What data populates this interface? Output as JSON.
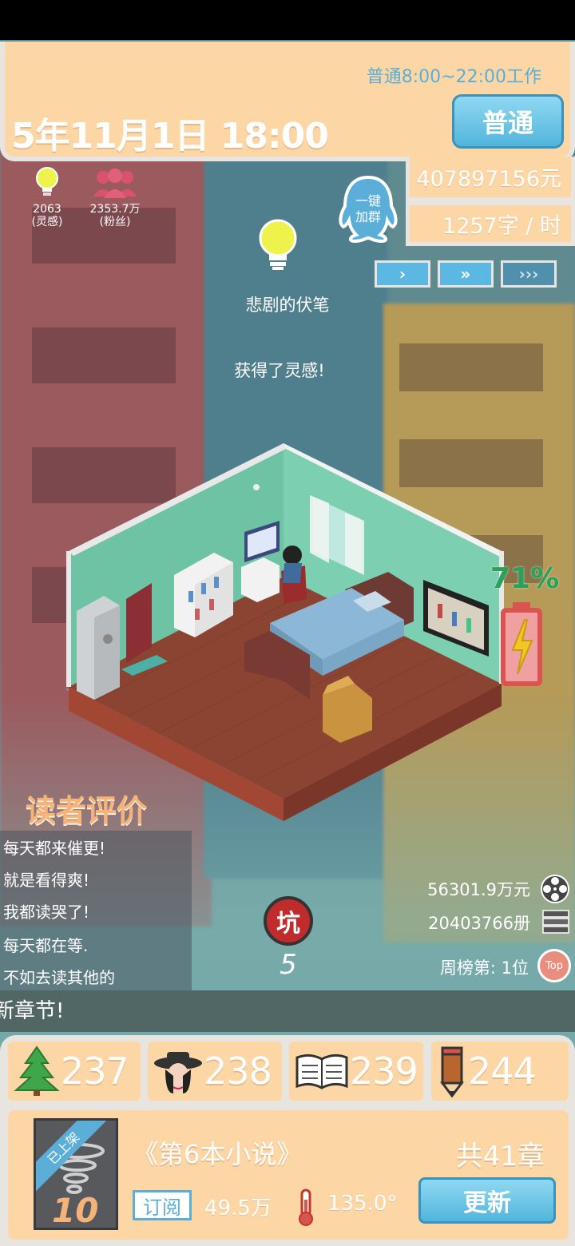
{
  "header": {
    "work_hours": "普通8:00~22:00工作",
    "date_time": "5年11月1日    18:00",
    "mode_button": "普通"
  },
  "stats": {
    "money": "407897156元",
    "writing_speed": "1257字 / 时",
    "inspiration_value": "2063",
    "inspiration_label": "(灵感)",
    "fans_value": "2353.7万",
    "fans_label": "(粉丝)"
  },
  "qq_group": {
    "line1": "一键",
    "line2": "加群"
  },
  "speed_controls": {
    "speed1": "›",
    "speed2": "»",
    "speed3": "›››"
  },
  "event": {
    "title": "悲剧的伏笔",
    "message": "获得了灵感!"
  },
  "battery": {
    "percent_label": "71%",
    "level": 0.71
  },
  "reviews": {
    "title": "读者评价",
    "lines": [
      "每天都来催更!",
      "就是看得爽!",
      "我都读哭了!",
      "每天都在等.",
      "不如去读其他的"
    ]
  },
  "pit": {
    "label": "坑",
    "count": "5"
  },
  "sales": {
    "revenue": "56301.9万元",
    "copies": "20403766册",
    "rank": "周榜第: 1位",
    "top_label": "Top"
  },
  "ticker": {
    "text": "新章节!"
  },
  "resources": [
    {
      "icon": "tree-icon",
      "value": "237"
    },
    {
      "icon": "character-icon",
      "value": "238"
    },
    {
      "icon": "book-icon",
      "value": "239"
    },
    {
      "icon": "pencil-icon",
      "value": "244"
    }
  ],
  "novel": {
    "status_ribbon": "已上架",
    "cover_number": "10",
    "title": "《第6本小说》",
    "chapters": "共41章",
    "subscribe_label": "订阅",
    "subscribers": "49.5万",
    "heat": "135.0°",
    "update_button": "更新"
  },
  "colors": {
    "panel": "#fcd7a5",
    "panel_border": "#e8e4df",
    "accent_blue": "#5aaed8",
    "battery_green": "#2ca05a",
    "battery_red": "#d9534f",
    "title_orange": "#f5b379"
  }
}
